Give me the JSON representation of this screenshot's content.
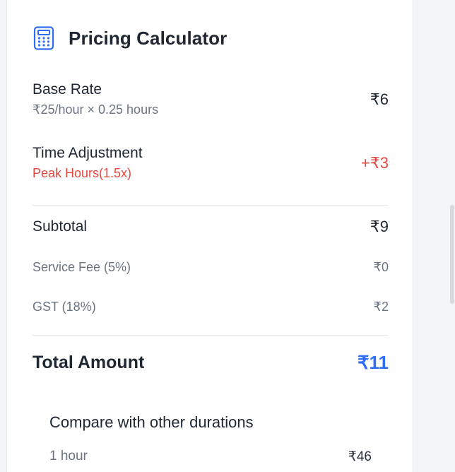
{
  "header": {
    "title": "Pricing Calculator",
    "icon": "calculator-icon"
  },
  "base_rate": {
    "label": "Base Rate",
    "detail": "₹25/hour × 0.25 hours",
    "value": "₹6"
  },
  "time_adjustment": {
    "label": "Time Adjustment",
    "detail": "Peak Hours(1.5x)",
    "value": "+₹3"
  },
  "subtotal": {
    "label": "Subtotal",
    "value": "₹9"
  },
  "service_fee": {
    "label": "Service Fee (5%)",
    "value": "₹0"
  },
  "gst": {
    "label": "GST (18%)",
    "value": "₹2"
  },
  "total": {
    "label": "Total Amount",
    "value": "₹11"
  },
  "compare": {
    "title": "Compare with other durations",
    "rows": [
      {
        "duration": "1 hour",
        "price": "₹46"
      }
    ]
  },
  "colors": {
    "accent": "#2f6df6",
    "negative": "#e5483e",
    "text": "#1f2733",
    "muted": "#6b7480"
  }
}
